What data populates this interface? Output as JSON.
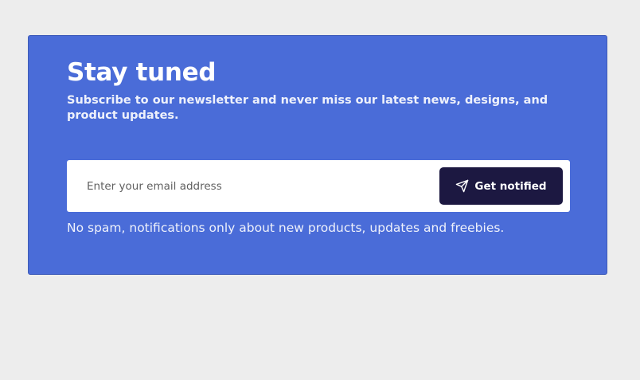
{
  "newsletter": {
    "title": "Stay tuned",
    "subtitle": "Subscribe to our newsletter and never miss our latest news, designs, and product updates.",
    "email_placeholder": "Enter your email address",
    "button_label": "Get notified",
    "button_icon": "paper-plane-icon",
    "note": "No spam, notifications only about new products, updates and freebies."
  },
  "colors": {
    "page_background": "#ededed",
    "card_background": "#4a6cd8",
    "button_background": "#1c1841",
    "text": "#ffffff"
  }
}
